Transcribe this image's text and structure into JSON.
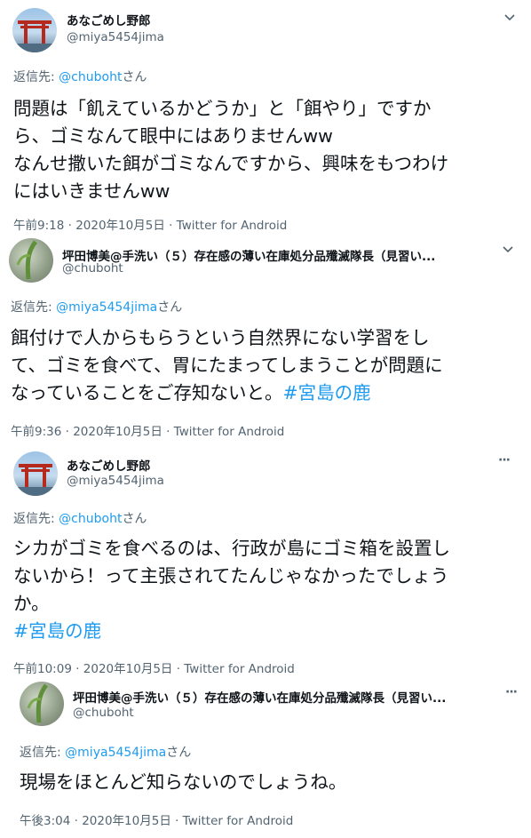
{
  "tweets": [
    {
      "name": "あなごめし野郎",
      "handle": "@miya5454jima",
      "menu_icon": "chevron-down-icon",
      "reply_prefix": "返信先: ",
      "reply_to": "@chuboht",
      "reply_suffix": "さん",
      "body_lines": [
        "問題は「飢えているかどうか」と「餌やり」ですか",
        "ら、ゴミなんて眼中にはありませんww",
        "なんせ撒いた餌がゴミなんですから、興味をもつわけ",
        "にはいきませんww"
      ],
      "meta": "午前9:18 · 2020年10月5日 · Twitter for Android"
    },
    {
      "name": "坪田博美@手洗い（５）存在感の薄い在庫処分品殲滅隊長（見習い...",
      "handle": "@chuboht",
      "menu_icon": "chevron-down-icon",
      "reply_prefix": "返信先: ",
      "reply_to": "@miya5454jima",
      "reply_suffix": "さん",
      "body_lines": [
        "餌付けで人からもらうという自然界にない学習をし",
        "て、ゴミを食べて、胃にたまってしまうことが問題に"
      ],
      "body_last_text": "なっていることをご存知ないと。",
      "hashtag": "#宮島の鹿",
      "meta": "午前9:36 · 2020年10月5日 · Twitter for Android"
    },
    {
      "name": "あなごめし野郎",
      "handle": "@miya5454jima",
      "menu_icon": "more-dots-icon",
      "menu_glyph": "···",
      "reply_prefix": "返信先: ",
      "reply_to": "@chuboht",
      "reply_suffix": "さん",
      "body_lines": [
        "シカがゴミを食べるのは、行政が島にゴミ箱を設置し",
        "ないから！って主張されてたんじゃなかったでしょう",
        "か。"
      ],
      "hashtag": "#宮島の鹿",
      "meta": "午前10:09 · 2020年10月5日 · Twitter for Android"
    },
    {
      "name": "坪田博美@手洗い（５）存在感の薄い在庫処分品殲滅隊長（見習い...",
      "handle": "@chuboht",
      "menu_icon": "more-dots-icon",
      "menu_glyph": "···",
      "reply_prefix": "返信先: ",
      "reply_to": "@miya5454jima",
      "reply_suffix": "さん",
      "body_lines": [
        "現場をほとんど知らないのでしょうね。"
      ],
      "meta": "午後3:04 · 2020年10月5日 · Twitter for Android"
    }
  ]
}
